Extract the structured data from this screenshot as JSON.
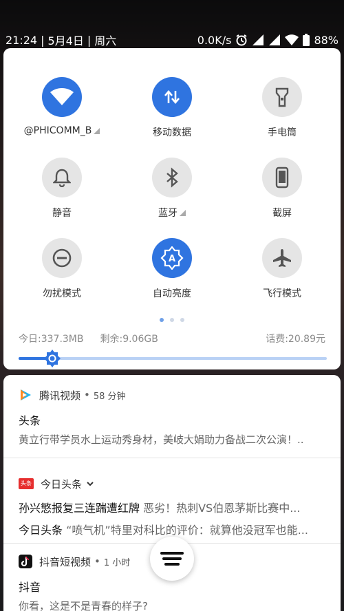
{
  "status_bar": {
    "time": "21:24",
    "date": "5月4日",
    "weekday": "周六",
    "sep": "|",
    "net_speed": "0.0K/s",
    "battery": "88%"
  },
  "quick_settings": {
    "tiles": [
      {
        "label": "@PHICOMM_B",
        "icon": "wifi-icon",
        "active": true
      },
      {
        "label": "移动数据",
        "icon": "mobile-data-icon",
        "active": true
      },
      {
        "label": "手电筒",
        "icon": "flashlight-icon",
        "active": false
      },
      {
        "label": "静音",
        "icon": "bell-icon",
        "active": false
      },
      {
        "label": "蓝牙",
        "icon": "bluetooth-icon",
        "active": false
      },
      {
        "label": "截屏",
        "icon": "phone-icon",
        "active": false
      },
      {
        "label": "勿扰模式",
        "icon": "do-not-disturb-icon",
        "active": false
      },
      {
        "label": "自动亮度",
        "icon": "auto-brightness-icon",
        "active": true
      },
      {
        "label": "飞行模式",
        "icon": "airplane-icon",
        "active": false
      }
    ],
    "page_indicator": {
      "pages": 3,
      "current": 1
    },
    "data_today": "今日:337.3MB",
    "data_remaining": "剩余:9.06GB",
    "balance": "话费:20.89元",
    "brightness": 0.11,
    "accent": "#2f74e0"
  },
  "notifications": {
    "tencent": {
      "app": "腾讯视频",
      "time": "58 分钟",
      "title": "头条",
      "body": "黄立行带学员水上运动秀身材，美岐大娟助力备战二次公演！.."
    },
    "toutiao": {
      "app": "今日头条",
      "icon_text": "头条",
      "line1_bold": "孙兴慜报复三连踹遭红牌",
      "line1_rest": "恶劣！热刺VS伯恩茅斯比赛中...",
      "line2_bold": "今日头条",
      "line2_rest": "“喷气机”特里对科比的评价：就算他没冠军也能..."
    },
    "douyin": {
      "app": "抖音短视频",
      "time": "1 小时",
      "title": "抖音",
      "body": "你看，这是不是青春的样子?"
    }
  }
}
